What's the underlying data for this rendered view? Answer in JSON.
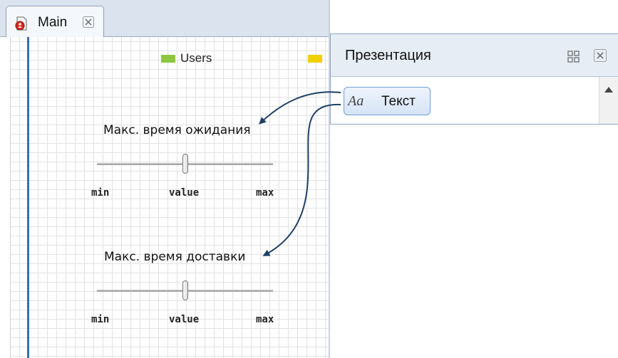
{
  "editor": {
    "tab_label": "Main",
    "legend": [
      {
        "label": "Users",
        "color": "#8dc63f"
      },
      {
        "label": "",
        "color": "#f2d000"
      }
    ]
  },
  "sliders": [
    {
      "title": "Макс. время ожидания",
      "min_label": "min",
      "value_label": "value",
      "max_label": "max",
      "position": 0.5
    },
    {
      "title": "Макс. время доставки",
      "min_label": "min",
      "value_label": "value",
      "max_label": "max",
      "position": 0.5
    }
  ],
  "palette": {
    "title": "Презентация",
    "item": {
      "icon_text": "Aa",
      "label": "Текст"
    }
  },
  "colors": {
    "arrow": "#1f3f66",
    "accent_line": "#3a6faf"
  }
}
